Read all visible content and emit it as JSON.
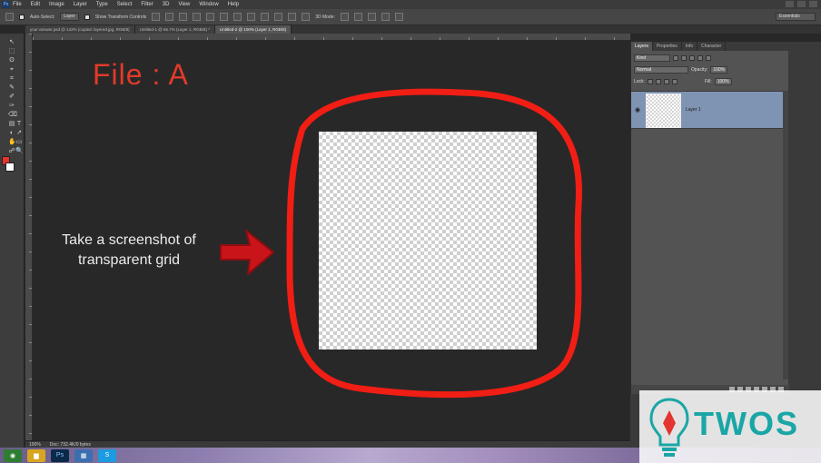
{
  "menu": {
    "app_badge": "Ps",
    "items": [
      "File",
      "Edit",
      "Image",
      "Layer",
      "Type",
      "Select",
      "Filter",
      "3D",
      "View",
      "Window",
      "Help"
    ]
  },
  "options": {
    "auto_select_label": "Auto-Select:",
    "auto_select_value": "Layer",
    "show_transform_label": "Show Transform Controls",
    "mode_3d_label": "3D Mode:",
    "workspace": "Essentials"
  },
  "tabs": [
    {
      "label": "your-answer.psd @ 142% (copied: layered.jpg, RGB/8)"
    },
    {
      "label": "Untitled-1 @ 66.7% (Layer 1, RGB/8) *"
    },
    {
      "label": "Untitled-2 @ 100% (Layer 1, RGB/8)"
    }
  ],
  "tools": [
    "↖",
    "⬚",
    "ʘ",
    "⌖",
    "⌗",
    "✎",
    "✐",
    "✑",
    "⌫",
    "▤",
    "◐",
    "✋",
    "T",
    "↗",
    "▭",
    "☍",
    "🔍"
  ],
  "canvas": {
    "title": "File : A",
    "instruction_line1": "Take a screenshot of",
    "instruction_line2": "transparent grid",
    "annotation_color": "#f01e14"
  },
  "status": {
    "zoom": "100%",
    "doc_info": "Doc: 732.4K/0 bytes"
  },
  "panel": {
    "tabs": [
      "Layers",
      "Properties",
      "Info",
      "Character"
    ],
    "kind_label": "Kind",
    "blend_mode": "Normal",
    "opacity_label": "Opacity:",
    "opacity_value": "100%",
    "lock_label": "Lock:",
    "fill_label": "Fill:",
    "fill_value": "100%",
    "layer_name": "Layer 1"
  },
  "taskbar": [
    {
      "name": "chrome",
      "glyph": "◉",
      "color": "#2e7d32"
    },
    {
      "name": "folder",
      "glyph": "▆",
      "color": "#d9a520"
    },
    {
      "name": "photoshop",
      "glyph": "Ps",
      "color": "#0b2a4a"
    },
    {
      "name": "explorer",
      "glyph": "▦",
      "color": "#3d6fb0"
    },
    {
      "name": "skype",
      "glyph": "S",
      "color": "#1b9be0"
    }
  ],
  "watermark": {
    "text": "TWOS",
    "color": "#1aa6a6"
  }
}
